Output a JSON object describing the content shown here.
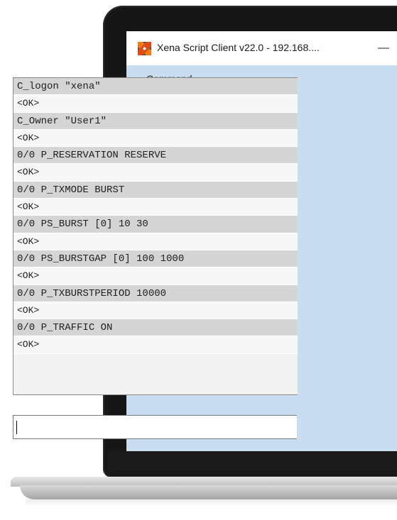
{
  "window": {
    "title": "Xena Script Client v22.0 - 192.168....",
    "minimize_glyph": "—",
    "app_icon": "xena-logo-icon",
    "title_color": "#1b1b1b",
    "accent_color": "#c9ddf1"
  },
  "menu": {
    "items": [
      {
        "label": "Command"
      }
    ]
  },
  "console": {
    "lines": [
      {
        "text": "C_logon \"xena\"",
        "kind": "cmd"
      },
      {
        "text": "<OK>",
        "kind": "resp"
      },
      {
        "text": "C_Owner \"User1\"",
        "kind": "cmd"
      },
      {
        "text": "<OK>",
        "kind": "resp"
      },
      {
        "text": "0/0 P_RESERVATION RESERVE",
        "kind": "cmd"
      },
      {
        "text": "<OK>",
        "kind": "resp"
      },
      {
        "text": "0/0 P_TXMODE BURST",
        "kind": "cmd"
      },
      {
        "text": "<OK>",
        "kind": "resp"
      },
      {
        "text": "0/0 PS_BURST [0] 10 30",
        "kind": "cmd"
      },
      {
        "text": "<OK>",
        "kind": "resp"
      },
      {
        "text": "0/0 PS_BURSTGAP [0] 100 1000",
        "kind": "cmd"
      },
      {
        "text": "<OK>",
        "kind": "resp"
      },
      {
        "text": "0/0 P_TXBURSTPERIOD 10000",
        "kind": "cmd"
      },
      {
        "text": "<OK>",
        "kind": "resp"
      },
      {
        "text": "0/0 P_TRAFFIC ON",
        "kind": "cmd"
      },
      {
        "text": "<OK>",
        "kind": "resp"
      }
    ]
  },
  "command_input": {
    "value": ""
  }
}
